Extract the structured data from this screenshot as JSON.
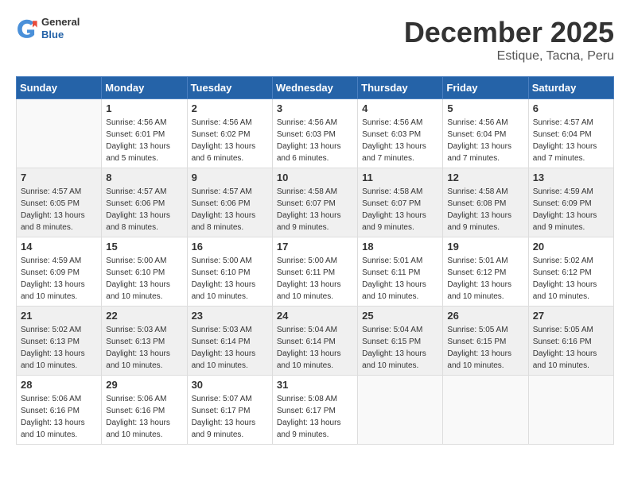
{
  "header": {
    "logo_general": "General",
    "logo_blue": "Blue",
    "month": "December 2025",
    "location": "Estique, Tacna, Peru"
  },
  "days_of_week": [
    "Sunday",
    "Monday",
    "Tuesday",
    "Wednesday",
    "Thursday",
    "Friday",
    "Saturday"
  ],
  "weeks": [
    [
      {
        "day": "",
        "info": ""
      },
      {
        "day": "1",
        "info": "Sunrise: 4:56 AM\nSunset: 6:01 PM\nDaylight: 13 hours\nand 5 minutes."
      },
      {
        "day": "2",
        "info": "Sunrise: 4:56 AM\nSunset: 6:02 PM\nDaylight: 13 hours\nand 6 minutes."
      },
      {
        "day": "3",
        "info": "Sunrise: 4:56 AM\nSunset: 6:03 PM\nDaylight: 13 hours\nand 6 minutes."
      },
      {
        "day": "4",
        "info": "Sunrise: 4:56 AM\nSunset: 6:03 PM\nDaylight: 13 hours\nand 7 minutes."
      },
      {
        "day": "5",
        "info": "Sunrise: 4:56 AM\nSunset: 6:04 PM\nDaylight: 13 hours\nand 7 minutes."
      },
      {
        "day": "6",
        "info": "Sunrise: 4:57 AM\nSunset: 6:04 PM\nDaylight: 13 hours\nand 7 minutes."
      }
    ],
    [
      {
        "day": "7",
        "info": "Sunrise: 4:57 AM\nSunset: 6:05 PM\nDaylight: 13 hours\nand 8 minutes."
      },
      {
        "day": "8",
        "info": "Sunrise: 4:57 AM\nSunset: 6:06 PM\nDaylight: 13 hours\nand 8 minutes."
      },
      {
        "day": "9",
        "info": "Sunrise: 4:57 AM\nSunset: 6:06 PM\nDaylight: 13 hours\nand 8 minutes."
      },
      {
        "day": "10",
        "info": "Sunrise: 4:58 AM\nSunset: 6:07 PM\nDaylight: 13 hours\nand 9 minutes."
      },
      {
        "day": "11",
        "info": "Sunrise: 4:58 AM\nSunset: 6:07 PM\nDaylight: 13 hours\nand 9 minutes."
      },
      {
        "day": "12",
        "info": "Sunrise: 4:58 AM\nSunset: 6:08 PM\nDaylight: 13 hours\nand 9 minutes."
      },
      {
        "day": "13",
        "info": "Sunrise: 4:59 AM\nSunset: 6:09 PM\nDaylight: 13 hours\nand 9 minutes."
      }
    ],
    [
      {
        "day": "14",
        "info": "Sunrise: 4:59 AM\nSunset: 6:09 PM\nDaylight: 13 hours\nand 10 minutes."
      },
      {
        "day": "15",
        "info": "Sunrise: 5:00 AM\nSunset: 6:10 PM\nDaylight: 13 hours\nand 10 minutes."
      },
      {
        "day": "16",
        "info": "Sunrise: 5:00 AM\nSunset: 6:10 PM\nDaylight: 13 hours\nand 10 minutes."
      },
      {
        "day": "17",
        "info": "Sunrise: 5:00 AM\nSunset: 6:11 PM\nDaylight: 13 hours\nand 10 minutes."
      },
      {
        "day": "18",
        "info": "Sunrise: 5:01 AM\nSunset: 6:11 PM\nDaylight: 13 hours\nand 10 minutes."
      },
      {
        "day": "19",
        "info": "Sunrise: 5:01 AM\nSunset: 6:12 PM\nDaylight: 13 hours\nand 10 minutes."
      },
      {
        "day": "20",
        "info": "Sunrise: 5:02 AM\nSunset: 6:12 PM\nDaylight: 13 hours\nand 10 minutes."
      }
    ],
    [
      {
        "day": "21",
        "info": "Sunrise: 5:02 AM\nSunset: 6:13 PM\nDaylight: 13 hours\nand 10 minutes."
      },
      {
        "day": "22",
        "info": "Sunrise: 5:03 AM\nSunset: 6:13 PM\nDaylight: 13 hours\nand 10 minutes."
      },
      {
        "day": "23",
        "info": "Sunrise: 5:03 AM\nSunset: 6:14 PM\nDaylight: 13 hours\nand 10 minutes."
      },
      {
        "day": "24",
        "info": "Sunrise: 5:04 AM\nSunset: 6:14 PM\nDaylight: 13 hours\nand 10 minutes."
      },
      {
        "day": "25",
        "info": "Sunrise: 5:04 AM\nSunset: 6:15 PM\nDaylight: 13 hours\nand 10 minutes."
      },
      {
        "day": "26",
        "info": "Sunrise: 5:05 AM\nSunset: 6:15 PM\nDaylight: 13 hours\nand 10 minutes."
      },
      {
        "day": "27",
        "info": "Sunrise: 5:05 AM\nSunset: 6:16 PM\nDaylight: 13 hours\nand 10 minutes."
      }
    ],
    [
      {
        "day": "28",
        "info": "Sunrise: 5:06 AM\nSunset: 6:16 PM\nDaylight: 13 hours\nand 10 minutes."
      },
      {
        "day": "29",
        "info": "Sunrise: 5:06 AM\nSunset: 6:16 PM\nDaylight: 13 hours\nand 10 minutes."
      },
      {
        "day": "30",
        "info": "Sunrise: 5:07 AM\nSunset: 6:17 PM\nDaylight: 13 hours\nand 9 minutes."
      },
      {
        "day": "31",
        "info": "Sunrise: 5:08 AM\nSunset: 6:17 PM\nDaylight: 13 hours\nand 9 minutes."
      },
      {
        "day": "",
        "info": ""
      },
      {
        "day": "",
        "info": ""
      },
      {
        "day": "",
        "info": ""
      }
    ]
  ]
}
